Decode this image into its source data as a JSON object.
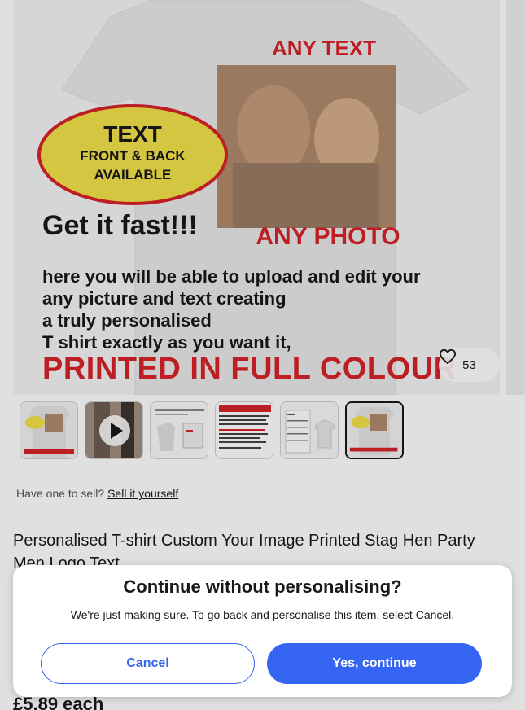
{
  "hero": {
    "shirt_text_top": "ANY TEXT",
    "badge_line1": "TEXT",
    "badge_line2": "FRONT & BACK",
    "badge_line3": "AVAILABLE",
    "headline": "Get it fast!!!",
    "photo_label": "ANY PHOTO",
    "body_line1": "here you will be able to upload and edit your",
    "body_line2": "any picture and text creating",
    "body_line3": "a truly personalised",
    "body_line4": "T shirt exactly as you want it,",
    "banner": "PRINTED IN FULL COLOUR",
    "favorites_count": "53",
    "favorite_icon": "heart-icon"
  },
  "thumbnails": [
    {
      "name": "thumb-1",
      "kind": "image"
    },
    {
      "name": "thumb-2",
      "kind": "video",
      "icon": "play-icon"
    },
    {
      "name": "thumb-3",
      "kind": "image"
    },
    {
      "name": "thumb-4",
      "kind": "image"
    },
    {
      "name": "thumb-5",
      "kind": "image"
    },
    {
      "name": "thumb-6",
      "kind": "image",
      "selected": true
    }
  ],
  "sell": {
    "prompt": "Have one to sell?",
    "link": "Sell it yourself"
  },
  "listing": {
    "title": "Personalised T-shirt Custom Your Image Printed Stag Hen Party Men Logo Text",
    "price": "£5.89 each"
  },
  "dialog": {
    "title": "Continue without personalising?",
    "message": "We're just making sure. To go back and personalise this item, select Cancel.",
    "cancel_label": "Cancel",
    "continue_label": "Yes, continue"
  },
  "colors": {
    "accent": "#3665f3",
    "text": "#191919",
    "banner_red": "#d8232a",
    "badge_yellow": "#f2e24b"
  }
}
